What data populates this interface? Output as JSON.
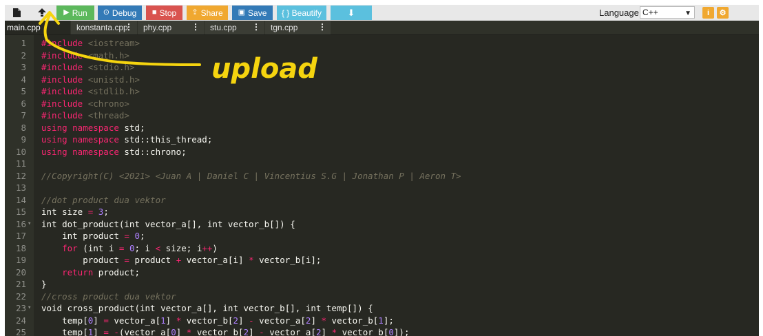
{
  "toolbar": {
    "buttons": {
      "run": "Run",
      "debug": "Debug",
      "stop": "Stop",
      "share": "Share",
      "save": "Save",
      "beautify": "{ } Beautify"
    },
    "language_label": "Language",
    "language_value": "C++",
    "colors": {
      "run": "#5cb85c",
      "debug": "#337ab7",
      "stop": "#d9534f",
      "share": "#f0a830",
      "save": "#337ab7",
      "beautify": "#5bc0de",
      "download": "#5bc0de"
    }
  },
  "tabs": [
    {
      "label": "main.cpp",
      "active": true
    },
    {
      "label": "konstanta.cpp",
      "active": false
    },
    {
      "label": "phy.cpp",
      "active": false
    },
    {
      "label": "stu.cpp",
      "active": false
    },
    {
      "label": "tgn.cpp",
      "active": false
    }
  ],
  "editor": {
    "line_numbers": [
      "1",
      "2",
      "3",
      "4",
      "5",
      "6",
      "7",
      "8",
      "9",
      "10",
      "11",
      "12",
      "13",
      "14",
      "15",
      "16",
      "17",
      "18",
      "19",
      "20",
      "21",
      "22",
      "23",
      "24",
      "25"
    ],
    "lines": {
      "l1": [
        "#include ",
        "<iostream>"
      ],
      "l2": [
        "#include ",
        "<math.h>"
      ],
      "l3": [
        "#include ",
        "<stdio.h>"
      ],
      "l4": [
        "#include ",
        "<unistd.h>"
      ],
      "l5": [
        "#include ",
        "<stdlib.h>"
      ],
      "l6": [
        "#include ",
        "<chrono>"
      ],
      "l7": [
        "#include ",
        "<thread>"
      ],
      "l8": [
        "using namespace",
        " std;"
      ],
      "l9": [
        "using namespace",
        " std::this_thread;"
      ],
      "l10": [
        "using namespace",
        " std::chrono;"
      ],
      "l12": "//Copyright(C) <2021> <Juan A | Daniel C | Vincentius S.G | Jonathan P | Aeron T>",
      "l14": "//dot product dua vektor",
      "l15": [
        "int size ",
        "=",
        " ",
        "3",
        ";"
      ],
      "l16": [
        "int dot_product(int vector_a[], int vector_b[]) {"
      ],
      "l17": [
        "    int product ",
        "=",
        " ",
        "0",
        ";"
      ],
      "l18": [
        "    ",
        "for",
        " (int i ",
        "=",
        " ",
        "0",
        "; i ",
        "<",
        " size; i",
        "++",
        ")"
      ],
      "l19": [
        "        product ",
        "=",
        " product ",
        "+",
        " vector_a[i] ",
        "*",
        " vector_b[i];"
      ],
      "l20": [
        "    ",
        "return",
        " product;"
      ],
      "l21": "}",
      "l22": "//cross product dua vektor",
      "l23": "void cross_product(int vector_a[], int vector_b[], int temp[]) {",
      "l24": [
        "    temp[",
        "0",
        "] ",
        "=",
        " vector_a[",
        "1",
        "] ",
        "*",
        " vector_b[",
        "2",
        "] ",
        "-",
        " vector_a[",
        "2",
        "] ",
        "*",
        " vector_b[",
        "1",
        "];"
      ],
      "l25": [
        "    temp[",
        "1",
        "] ",
        "=",
        " ",
        "-",
        "(vector_a[",
        "0",
        "] ",
        "*",
        " vector_b[",
        "2",
        "] ",
        "-",
        " vector_a[",
        "2",
        "] ",
        "*",
        " vector_b[",
        "0",
        "]);"
      ]
    }
  },
  "annotation": {
    "text": "upload",
    "color": "#f5d40f"
  }
}
